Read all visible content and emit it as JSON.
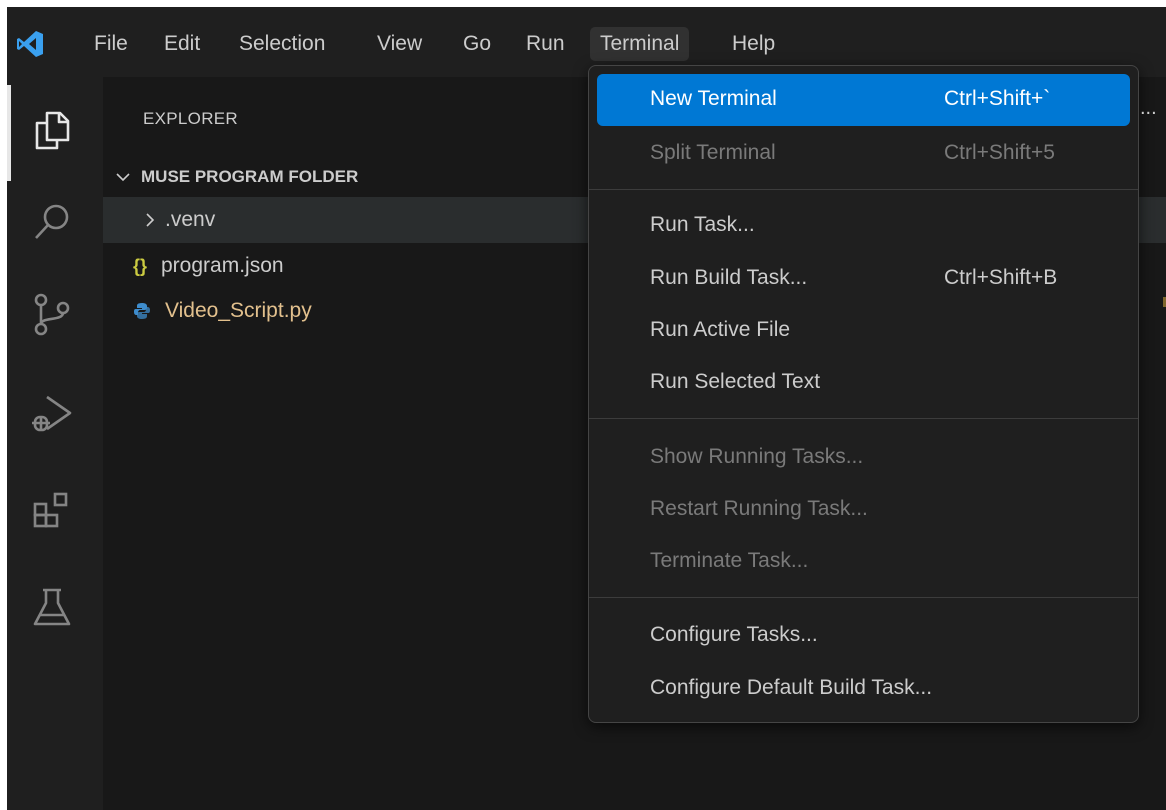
{
  "menubar": {
    "items": [
      "File",
      "Edit",
      "Selection",
      "View",
      "Go",
      "Run",
      "Terminal",
      "Help"
    ],
    "active": "Terminal"
  },
  "activitybar": {
    "icons": [
      "explorer-icon",
      "search-icon",
      "source-control-icon",
      "run-debug-icon",
      "extensions-icon",
      "testing-icon"
    ]
  },
  "sidebar": {
    "title": "EXPLORER",
    "folder": "MUSE PROGRAM FOLDER",
    "items": [
      {
        "label": ".venv",
        "type": "folder"
      },
      {
        "label": "program.json",
        "type": "json",
        "icon_text": "{}"
      },
      {
        "label": "Video_Script.py",
        "type": "python"
      }
    ]
  },
  "terminal_menu": {
    "groups": [
      [
        {
          "label": "New Terminal",
          "shortcut": "Ctrl+Shift+`",
          "state": "highlighted"
        },
        {
          "label": "Split Terminal",
          "shortcut": "Ctrl+Shift+5",
          "state": "disabled"
        }
      ],
      [
        {
          "label": "Run Task...",
          "shortcut": ""
        },
        {
          "label": "Run Build Task...",
          "shortcut": "Ctrl+Shift+B"
        },
        {
          "label": "Run Active File",
          "shortcut": ""
        },
        {
          "label": "Run Selected Text",
          "shortcut": ""
        }
      ],
      [
        {
          "label": "Show Running Tasks...",
          "shortcut": "",
          "state": "disabled"
        },
        {
          "label": "Restart Running Task...",
          "shortcut": "",
          "state": "disabled"
        },
        {
          "label": "Terminate Task...",
          "shortcut": "",
          "state": "disabled"
        }
      ],
      [
        {
          "label": "Configure Tasks...",
          "shortcut": ""
        },
        {
          "label": "Configure Default Build Task...",
          "shortcut": ""
        }
      ]
    ]
  },
  "overflow": "...",
  "colors": {
    "accent": "#0078d4",
    "python_icon": "#3e8ccc",
    "python_file_text": "#e2c08d",
    "json_icon": "#cbcb41"
  }
}
